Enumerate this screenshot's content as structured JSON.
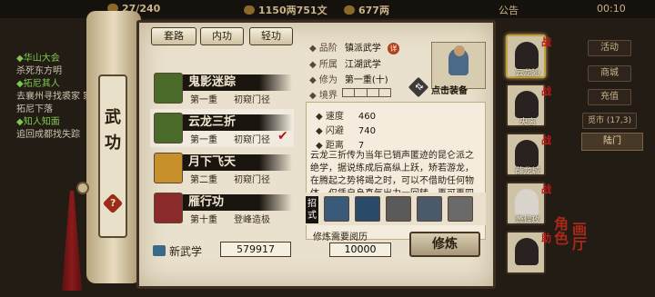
{
  "topbar": {
    "energy": "27/240",
    "money": "1150两751文",
    "gold": "677两",
    "notice": "公告",
    "time": "00:10"
  },
  "quests": [
    {
      "title": "◆华山大会",
      "desc": "杀死东方明"
    },
    {
      "title": "◆拓尼其人",
      "desc": "去襄州寻找裘家 家拓尼下落"
    },
    {
      "title": "◆知人知面",
      "desc": "追回成都找失踪"
    }
  ],
  "side_panel": {
    "title": "武功",
    "help": "?"
  },
  "tabs": [
    "套路",
    "内功",
    "轻功"
  ],
  "skills": [
    {
      "name": "鬼影迷踪",
      "level": "第一重",
      "tier": "初窥门径",
      "icon_color": "#4a6a2a",
      "checked": false
    },
    {
      "name": "云龙三折",
      "level": "第一重",
      "tier": "初窥门径",
      "icon_color": "#4a6a2a",
      "checked": true
    },
    {
      "name": "月下飞天",
      "level": "第二重",
      "tier": "初窥门径",
      "icon_color": "#c8902a",
      "checked": false
    },
    {
      "name": "雁行功",
      "level": "第十重",
      "tier": "登峰造极",
      "icon_color": "#8a2a2a",
      "checked": false
    }
  ],
  "new_skill": {
    "label": "新武学",
    "points": "579917"
  },
  "detail": {
    "rank_label": "品阶",
    "rank": "镇派武学",
    "rank_badge": "详",
    "owner_label": "所属",
    "owner": "江湖武学",
    "cultivation_label": "修为",
    "cultivation": "第一重(十)",
    "realm_label": "境界",
    "equip_label": "点击装备",
    "stats": [
      {
        "label": "速度",
        "value": "460"
      },
      {
        "label": "闪避",
        "value": "740"
      },
      {
        "label": "距离",
        "value": "7"
      }
    ],
    "description": "云龙三折传为当年已销声匿迹的昆仑派之绝学，据说练成后高纵上跃，矫若游龙，在腾起之势将竭之时，可以不借助任何物体，仅凭自身真气出力一回转，再可再四腾身",
    "moves_label": "招式",
    "move_colors": [
      "#3a5a7a",
      "#2a4a6a",
      "#5a5a5a",
      "#4a5a6a",
      "#6a6a6a"
    ],
    "cost_label": "修炼需要阅历",
    "cost": "10000",
    "train_label": "修炼"
  },
  "roster": [
    {
      "name": "云龙沁",
      "mark": "战",
      "selected": true
    },
    {
      "name": "央离",
      "mark": "战",
      "selected": false
    },
    {
      "name": "薛龙城",
      "mark": "战",
      "selected": false
    },
    {
      "name": "萧偃玫",
      "mark": "战",
      "selected": false
    },
    {
      "name": "",
      "mark": "助",
      "selected": false
    }
  ],
  "right_ui": {
    "buttons": [
      "活动",
      "商城",
      "充值"
    ],
    "map": "陆门",
    "map_status": "觅市 (17,3)"
  },
  "role_text": "角色",
  "hall_text": "画厅"
}
